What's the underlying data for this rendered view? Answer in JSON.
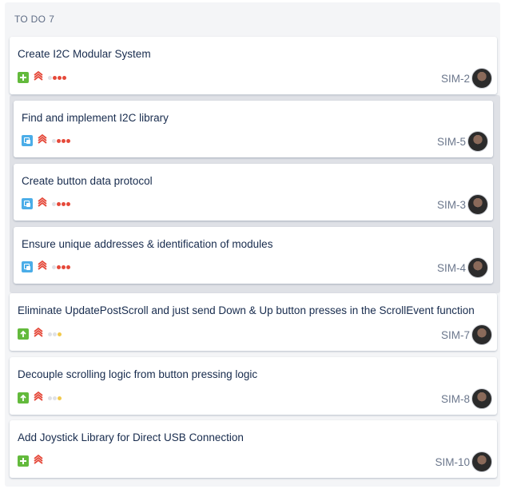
{
  "column": {
    "title": "TO DO",
    "count": "7"
  },
  "colors": {
    "story": "#63ba3c",
    "subtask": "#4bade8",
    "priority_high": "#e5493a",
    "priority_low": "#f2c94c",
    "dot_muted": "#dfe1e6"
  },
  "cards": [
    {
      "title": "Create I2C Modular System",
      "key": "SIM-2",
      "type_icon": "story-plus-icon",
      "priority_icon": "highest-priority-icon",
      "dots": [
        "muted",
        "high",
        "high",
        "high"
      ]
    },
    {
      "title": "Find and implement I2C library",
      "key": "SIM-5",
      "type_icon": "subtask-icon",
      "priority_icon": "highest-priority-icon",
      "dots": [
        "muted",
        "high",
        "high",
        "high"
      ]
    },
    {
      "title": "Create button data protocol",
      "key": "SIM-3",
      "type_icon": "subtask-icon",
      "priority_icon": "highest-priority-icon",
      "dots": [
        "muted",
        "high",
        "high",
        "high"
      ]
    },
    {
      "title": "Ensure unique addresses & identification of modules",
      "key": "SIM-4",
      "type_icon": "subtask-icon",
      "priority_icon": "highest-priority-icon",
      "dots": [
        "muted",
        "high",
        "high",
        "high"
      ]
    },
    {
      "title": "Eliminate UpdatePostScroll and just send Down & Up button presses in the ScrollEvent function",
      "key": "SIM-7",
      "type_icon": "improvement-arrow-icon",
      "priority_icon": "highest-priority-icon",
      "dots": [
        "muted",
        "muted",
        "low"
      ]
    },
    {
      "title": "Decouple scrolling logic from button pressing logic",
      "key": "SIM-8",
      "type_icon": "improvement-arrow-icon",
      "priority_icon": "highest-priority-icon",
      "dots": [
        "muted",
        "muted",
        "low"
      ]
    },
    {
      "title": "Add Joystick Library for Direct USB Connection",
      "key": "SIM-10",
      "type_icon": "story-plus-icon",
      "priority_icon": "highest-priority-icon",
      "dots": []
    }
  ]
}
